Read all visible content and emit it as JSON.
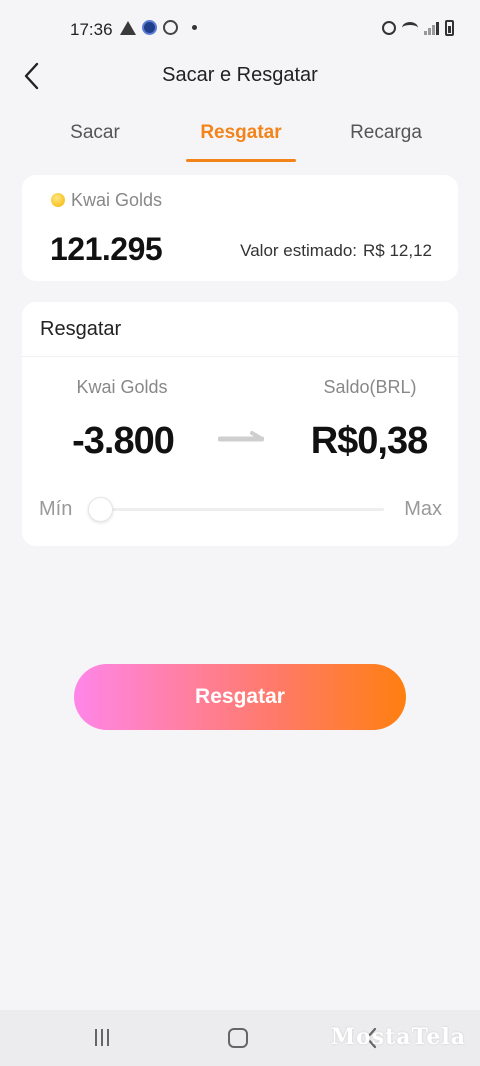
{
  "status_bar": {
    "time": "17:36"
  },
  "header": {
    "title": "Sacar e Resgatar",
    "back_icon": "chevron-left-icon"
  },
  "tabs": [
    {
      "label": "Sacar",
      "active": false
    },
    {
      "label": "Resgatar",
      "active": true
    },
    {
      "label": "Recarga",
      "active": false
    }
  ],
  "balance": {
    "label": "Kwai Golds",
    "value": "121.295",
    "estimate_label": "Valor estimado:",
    "estimate_value": "R$ 12,12"
  },
  "redeem": {
    "title": "Resgatar",
    "from_label": "Kwai Golds",
    "from_value": "-3.800",
    "to_label": "Saldo(BRL)",
    "to_value": "R$0,38",
    "slider_min": "Mín",
    "slider_max": "Max",
    "slider_level": 0
  },
  "button": {
    "label": "Resgatar"
  },
  "watermark": "MostaTela",
  "colors": {
    "accent": "#f2841a",
    "button_start": "#ff86e8",
    "button_end": "#ff7f10",
    "background": "#f5f5f8"
  }
}
